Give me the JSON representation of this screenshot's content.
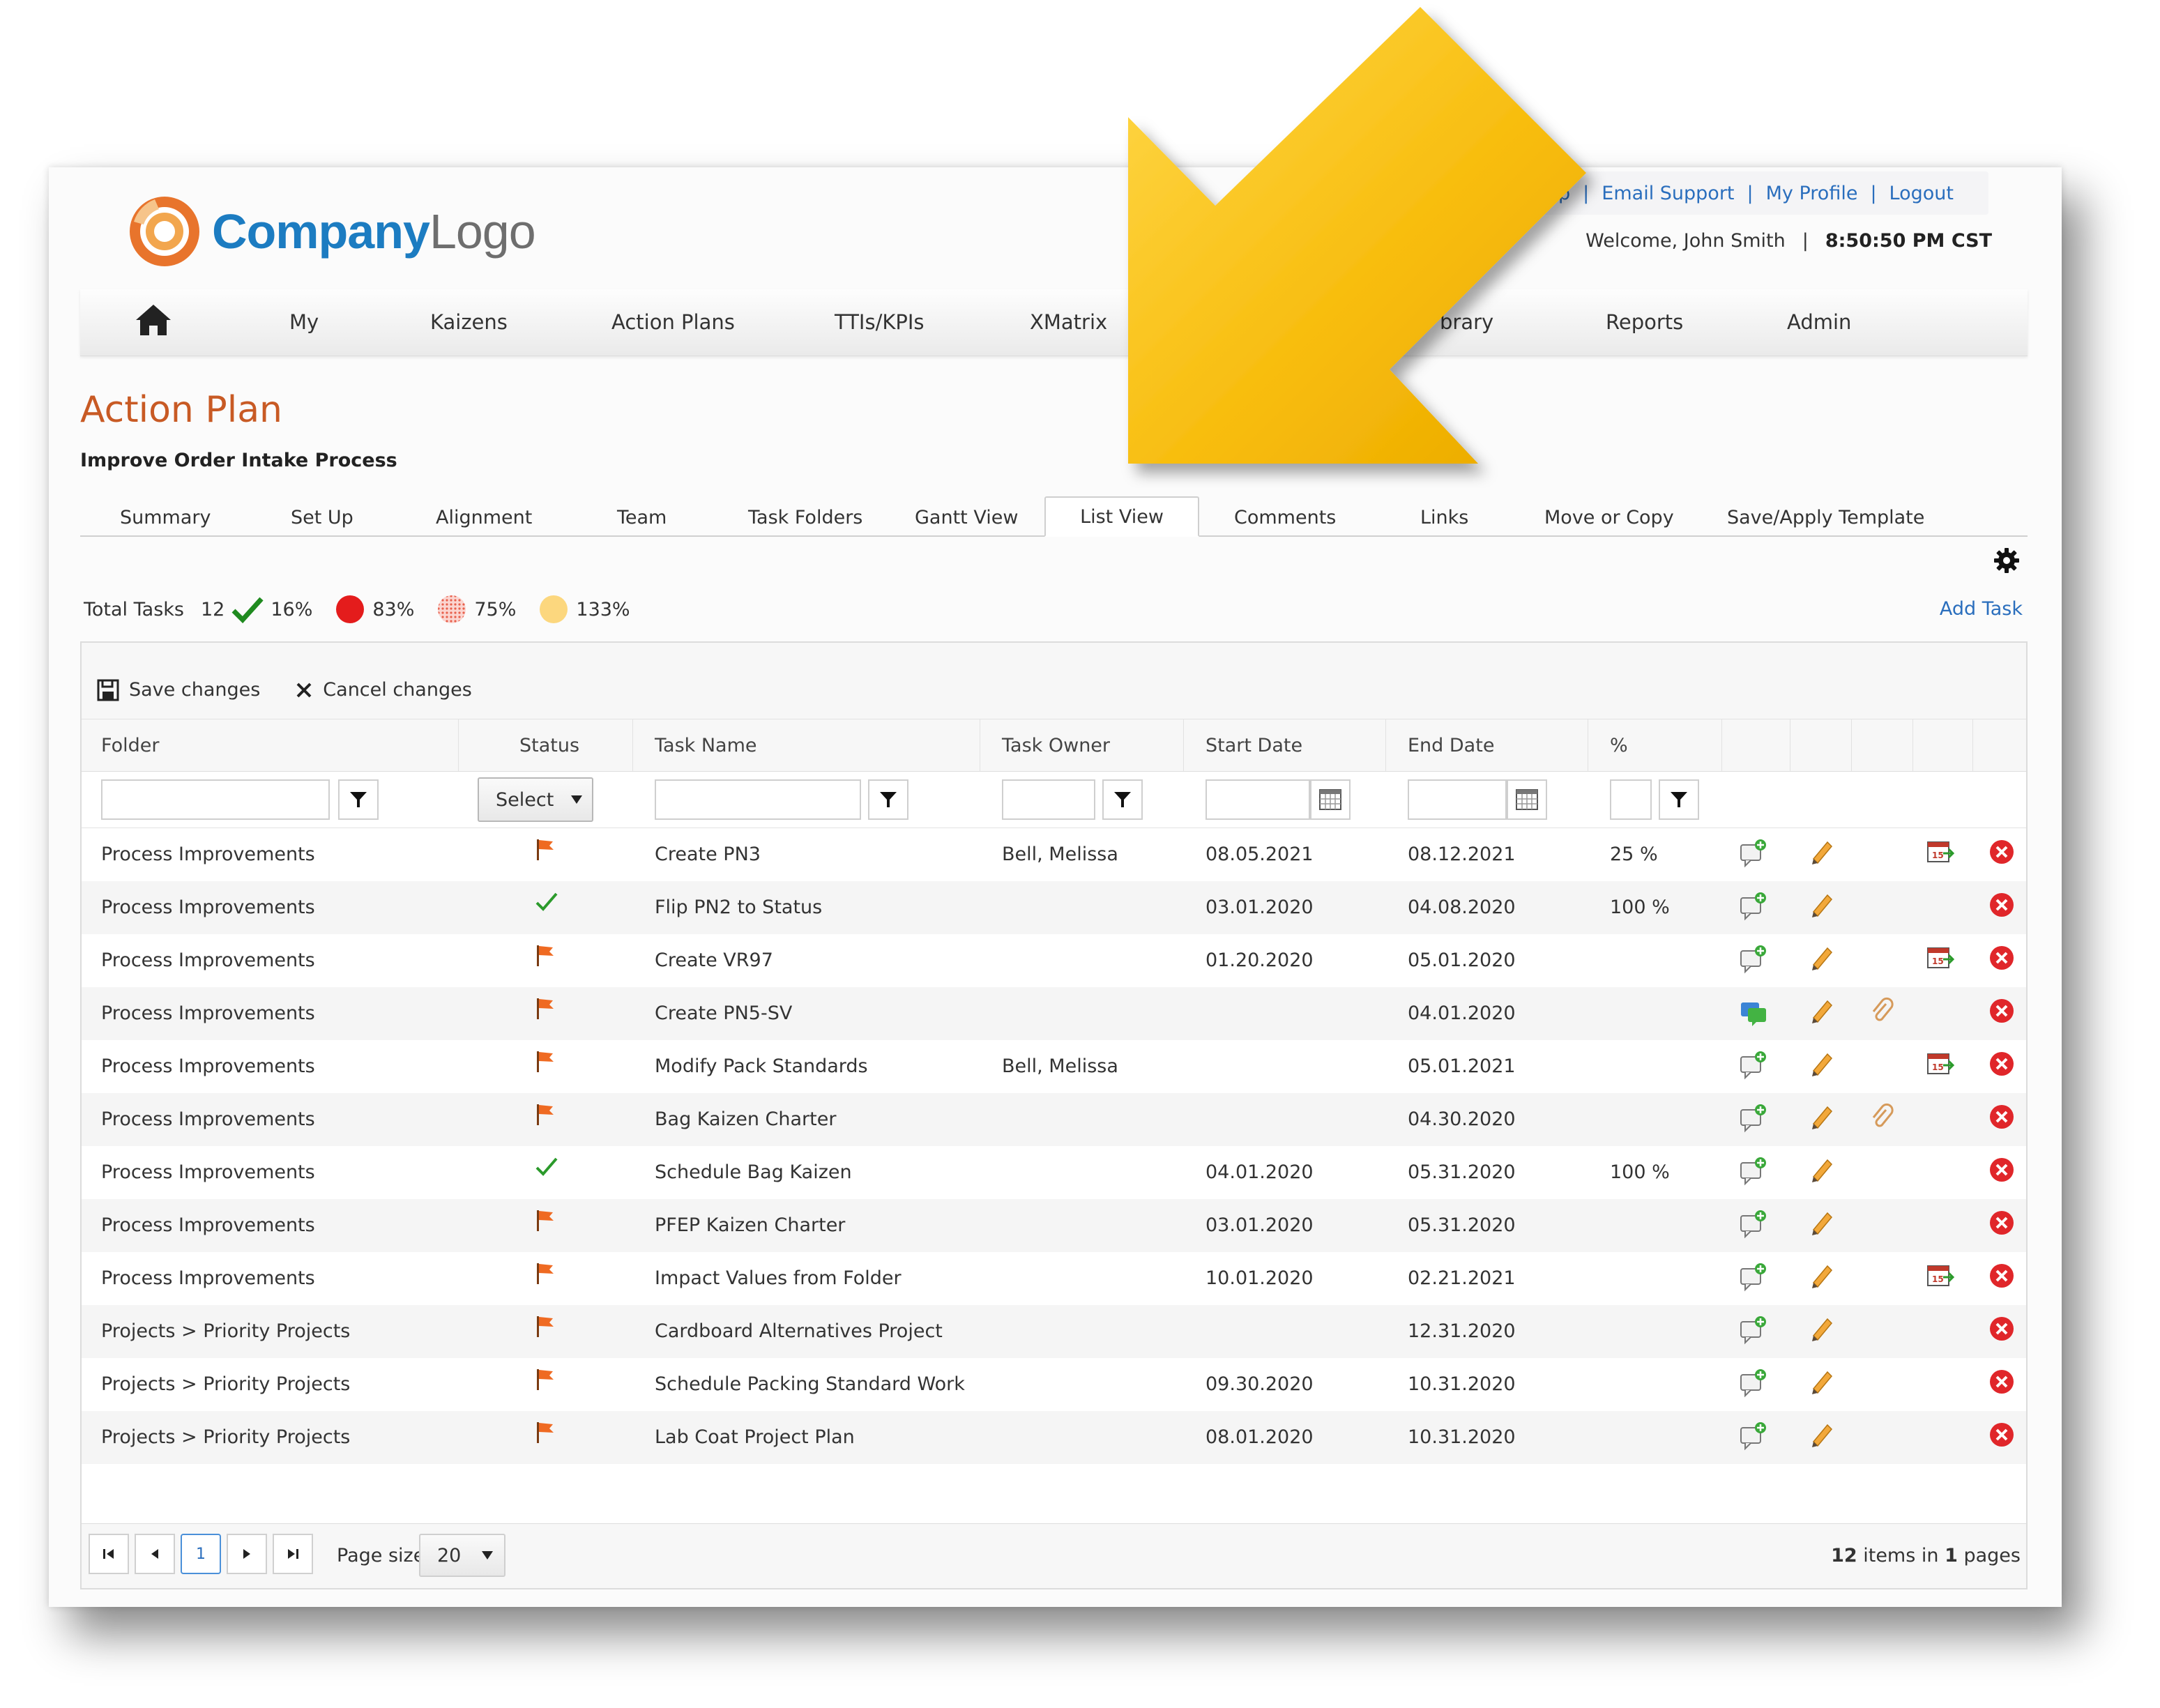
{
  "header": {
    "logo_part1": "Company",
    "logo_part2": "Logo",
    "links": [
      "Help",
      "Email Support",
      "My Profile",
      "Logout"
    ],
    "welcome": "Welcome, John Smith",
    "time": "8:50:50 PM CST"
  },
  "nav": {
    "items": [
      "My",
      "Kaizens",
      "Action Plans",
      "TTIs/KPIs",
      "XMatrix",
      "brary",
      "Reports",
      "Admin"
    ]
  },
  "page": {
    "title": "Action Plan",
    "subtitle": "Improve Order Intake Process"
  },
  "tabs": [
    "Summary",
    "Set Up",
    "Alignment",
    "Team",
    "Task Folders",
    "Gantt View",
    "List View",
    "Comments",
    "Links",
    "Move or Copy",
    "Save/Apply Template"
  ],
  "active_tab": "List View",
  "stats": {
    "label": "Total Tasks",
    "total": "12",
    "complete_pct": "16%",
    "red_pct": "83%",
    "hatched_pct": "75%",
    "yellow_pct": "133%"
  },
  "actions": {
    "add_task": "Add Task",
    "save_changes": "Save changes",
    "cancel_changes": "Cancel changes"
  },
  "grid": {
    "columns": [
      "Folder",
      "Status",
      "Task Name",
      "Task Owner",
      "Start Date",
      "End Date",
      "%"
    ],
    "status_select": "Select",
    "rows": [
      {
        "folder": "Process Improvements",
        "status": "flag",
        "task": "Create PN3",
        "owner": "Bell, Melissa",
        "start": "08.05.2021",
        "end": "08.12.2021",
        "pct": "25 %",
        "comment": "add",
        "attach": false,
        "calendar": true
      },
      {
        "folder": "Process Improvements",
        "status": "check",
        "task": "Flip PN2 to Status",
        "owner": "",
        "start": "03.01.2020",
        "end": "04.08.2020",
        "pct": "100 %",
        "comment": "add",
        "attach": false,
        "calendar": false
      },
      {
        "folder": "Process Improvements",
        "status": "flag",
        "task": "Create VR97",
        "owner": "",
        "start": "01.20.2020",
        "end": "05.01.2020",
        "pct": "",
        "comment": "add",
        "attach": false,
        "calendar": true
      },
      {
        "folder": "Process Improvements",
        "status": "flag",
        "task": "Create PN5-SV",
        "owner": "",
        "start": "",
        "end": "04.01.2020",
        "pct": "",
        "comment": "has",
        "attach": true,
        "calendar": false
      },
      {
        "folder": "Process Improvements",
        "status": "flag",
        "task": "Modify Pack Standards",
        "owner": "Bell, Melissa",
        "start": "",
        "end": "05.01.2021",
        "pct": "",
        "comment": "add",
        "attach": false,
        "calendar": true
      },
      {
        "folder": "Process Improvements",
        "status": "flag",
        "task": "Bag Kaizen Charter",
        "owner": "",
        "start": "",
        "end": "04.30.2020",
        "pct": "",
        "comment": "add",
        "attach": true,
        "calendar": false
      },
      {
        "folder": "Process Improvements",
        "status": "check",
        "task": "Schedule Bag Kaizen",
        "owner": "",
        "start": "04.01.2020",
        "end": "05.31.2020",
        "pct": "100 %",
        "comment": "add",
        "attach": false,
        "calendar": false
      },
      {
        "folder": "Process Improvements",
        "status": "flag",
        "task": "PFEP Kaizen Charter",
        "owner": "",
        "start": "03.01.2020",
        "end": "05.31.2020",
        "pct": "",
        "comment": "add",
        "attach": false,
        "calendar": false
      },
      {
        "folder": "Process Improvements",
        "status": "flag",
        "task": "Impact Values from Folder",
        "owner": "",
        "start": "10.01.2020",
        "end": "02.21.2021",
        "pct": "",
        "comment": "add",
        "attach": false,
        "calendar": true
      },
      {
        "folder": "Projects > Priority Projects",
        "status": "flag",
        "task": "Cardboard Alternatives Project",
        "owner": "",
        "start": "",
        "end": "12.31.2020",
        "pct": "",
        "comment": "add",
        "attach": false,
        "calendar": false
      },
      {
        "folder": "Projects > Priority Projects",
        "status": "flag",
        "task": "Schedule Packing Standard Work",
        "owner": "",
        "start": "09.30.2020",
        "end": "10.31.2020",
        "pct": "",
        "comment": "add",
        "attach": false,
        "calendar": false
      },
      {
        "folder": "Projects > Priority Projects",
        "status": "flag",
        "task": "Lab Coat Project Plan",
        "owner": "",
        "start": "08.01.2020",
        "end": "10.31.2020",
        "pct": "",
        "comment": "add",
        "attach": false,
        "calendar": false
      }
    ]
  },
  "pager": {
    "current_page": "1",
    "page_size_label": "Page size:",
    "page_size": "20",
    "items_count": "12",
    "items_mid": "items in",
    "pages_count": "1",
    "pages_label": "pages"
  },
  "colors": {
    "brand_orange": "#c85a24",
    "link_blue": "#2a6ebd",
    "logo_blue": "#1c7cc1",
    "delete_red": "#e0262a",
    "arrow_yellow": "#f5b800"
  },
  "icons": {
    "home": "home-icon",
    "gear": "gear-icon",
    "filter": "filter-icon",
    "calendar": "calendar-icon",
    "flag": "flag-icon",
    "check": "checkmark-icon",
    "comment": "add-comment-icon",
    "edit": "pencil-icon",
    "attach": "paperclip-icon",
    "schedule": "calendar-move-icon",
    "delete": "delete-icon",
    "save": "floppy-disk-icon",
    "cancel": "close-icon",
    "callout": "arrow-callout"
  }
}
